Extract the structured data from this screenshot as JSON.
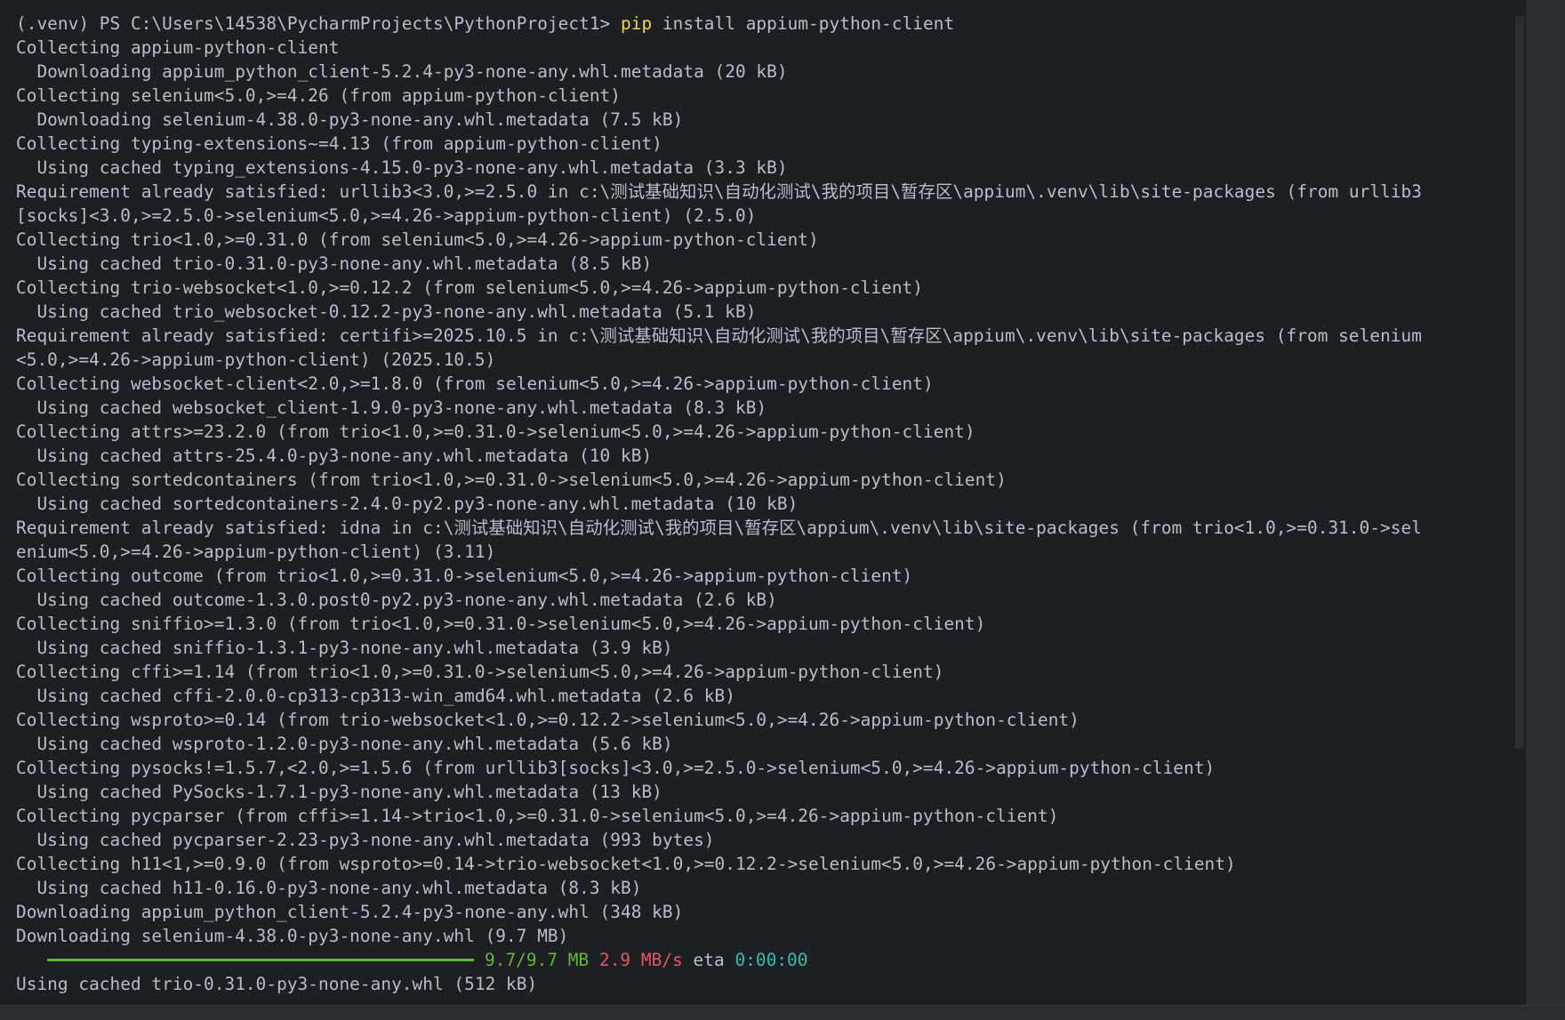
{
  "terminal": {
    "prompt": "(.venv) PS C:\\Users\\14538\\PycharmProjects\\PythonProject1> ",
    "command_keyword": "pip",
    "command_args": " install appium-python-client",
    "lines": [
      "Collecting appium-python-client",
      "  Downloading appium_python_client-5.2.4-py3-none-any.whl.metadata (20 kB)",
      "Collecting selenium<5.0,>=4.26 (from appium-python-client)",
      "  Downloading selenium-4.38.0-py3-none-any.whl.metadata (7.5 kB)",
      "Collecting typing-extensions~=4.13 (from appium-python-client)",
      "  Using cached typing_extensions-4.15.0-py3-none-any.whl.metadata (3.3 kB)",
      "Requirement already satisfied: urllib3<3.0,>=2.5.0 in c:\\测试基础知识\\自动化测试\\我的项目\\暂存区\\appium\\.venv\\lib\\site-packages (from urllib3",
      "[socks]<3.0,>=2.5.0->selenium<5.0,>=4.26->appium-python-client) (2.5.0)",
      "Collecting trio<1.0,>=0.31.0 (from selenium<5.0,>=4.26->appium-python-client)",
      "  Using cached trio-0.31.0-py3-none-any.whl.metadata (8.5 kB)",
      "Collecting trio-websocket<1.0,>=0.12.2 (from selenium<5.0,>=4.26->appium-python-client)",
      "  Using cached trio_websocket-0.12.2-py3-none-any.whl.metadata (5.1 kB)",
      "Requirement already satisfied: certifi>=2025.10.5 in c:\\测试基础知识\\自动化测试\\我的项目\\暂存区\\appium\\.venv\\lib\\site-packages (from selenium",
      "<5.0,>=4.26->appium-python-client) (2025.10.5)",
      "Collecting websocket-client<2.0,>=1.8.0 (from selenium<5.0,>=4.26->appium-python-client)",
      "  Using cached websocket_client-1.9.0-py3-none-any.whl.metadata (8.3 kB)",
      "Collecting attrs>=23.2.0 (from trio<1.0,>=0.31.0->selenium<5.0,>=4.26->appium-python-client)",
      "  Using cached attrs-25.4.0-py3-none-any.whl.metadata (10 kB)",
      "Collecting sortedcontainers (from trio<1.0,>=0.31.0->selenium<5.0,>=4.26->appium-python-client)",
      "  Using cached sortedcontainers-2.4.0-py2.py3-none-any.whl.metadata (10 kB)",
      "Requirement already satisfied: idna in c:\\测试基础知识\\自动化测试\\我的项目\\暂存区\\appium\\.venv\\lib\\site-packages (from trio<1.0,>=0.31.0->sel",
      "enium<5.0,>=4.26->appium-python-client) (3.11)",
      "Collecting outcome (from trio<1.0,>=0.31.0->selenium<5.0,>=4.26->appium-python-client)",
      "  Using cached outcome-1.3.0.post0-py2.py3-none-any.whl.metadata (2.6 kB)",
      "Collecting sniffio>=1.3.0 (from trio<1.0,>=0.31.0->selenium<5.0,>=4.26->appium-python-client)",
      "  Using cached sniffio-1.3.1-py3-none-any.whl.metadata (3.9 kB)",
      "Collecting cffi>=1.14 (from trio<1.0,>=0.31.0->selenium<5.0,>=4.26->appium-python-client)",
      "  Using cached cffi-2.0.0-cp313-cp313-win_amd64.whl.metadata (2.6 kB)",
      "Collecting wsproto>=0.14 (from trio-websocket<1.0,>=0.12.2->selenium<5.0,>=4.26->appium-python-client)",
      "  Using cached wsproto-1.2.0-py3-none-any.whl.metadata (5.6 kB)",
      "Collecting pysocks!=1.5.7,<2.0,>=1.5.6 (from urllib3[socks]<3.0,>=2.5.0->selenium<5.0,>=4.26->appium-python-client)",
      "  Using cached PySocks-1.7.1-py3-none-any.whl.metadata (13 kB)",
      "Collecting pycparser (from cffi>=1.14->trio<1.0,>=0.31.0->selenium<5.0,>=4.26->appium-python-client)",
      "  Using cached pycparser-2.23-py3-none-any.whl.metadata (993 bytes)",
      "Collecting h11<1,>=0.9.0 (from wsproto>=0.14->trio-websocket<1.0,>=0.12.2->selenium<5.0,>=4.26->appium-python-client)",
      "  Using cached h11-0.16.0-py3-none-any.whl.metadata (8.3 kB)",
      "Downloading appium_python_client-5.2.4-py3-none-any.whl (348 kB)",
      "Downloading selenium-4.38.0-py3-none-any.whl (9.7 MB)"
    ],
    "progress": {
      "fraction": 1.0,
      "size": "9.7/9.7 MB",
      "speed": "2.9 MB/s",
      "eta_label": "eta",
      "eta": "0:00:00"
    },
    "after_lines": [
      "Using cached trio-0.31.0-py3-none-any.whl (512 kB)"
    ]
  },
  "colors": {
    "background": "#1e1f22",
    "text": "#bcbec4",
    "command_keyword": "#f0d64f",
    "progress_bar": "#5fb832",
    "progress_size": "#5fb832",
    "progress_speed": "#e0566a",
    "progress_eta": "#2fbdb0"
  }
}
